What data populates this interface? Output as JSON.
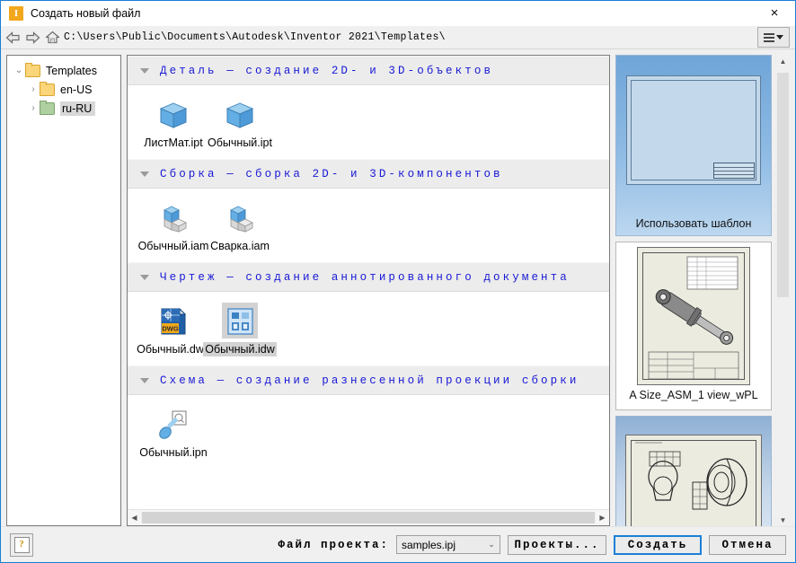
{
  "window": {
    "title": "Создать новый файл",
    "app_icon": "I",
    "close_icon": "×",
    "accent_color": "#1a7fd4"
  },
  "addressbar": {
    "back_icon": "back-arrow-icon",
    "forward_icon": "forward-arrow-icon",
    "home_icon": "home-icon",
    "path": "C:\\Users\\Public\\Documents\\Autodesk\\Inventor 2021\\Templates\\",
    "view_menu_icon": "view-options-icon"
  },
  "tree": {
    "items": [
      {
        "label": "Templates",
        "twisty": "⌄",
        "folder_color": "#fbd57a",
        "level": 0,
        "selected": false
      },
      {
        "label": "en-US",
        "twisty": "›",
        "folder_color": "#fbd57a",
        "level": 1,
        "selected": false
      },
      {
        "label": "ru-RU",
        "twisty": "›",
        "folder_color": "#aecfa0",
        "level": 1,
        "selected": true
      }
    ]
  },
  "sections": [
    {
      "title": "Деталь — создание 2D- и 3D-объектов",
      "items": [
        {
          "name": "ЛистМат.ipt",
          "icon": "part-cube-icon",
          "selected": false
        },
        {
          "name": "Обычный.ipt",
          "icon": "part-cube-icon",
          "selected": false
        }
      ]
    },
    {
      "title": "Сборка — сборка 2D- и 3D-компонентов",
      "items": [
        {
          "name": "Обычный.iam",
          "icon": "assembly-icon",
          "selected": false
        },
        {
          "name": "Сварка.iam",
          "icon": "assembly-icon",
          "selected": false
        }
      ]
    },
    {
      "title": "Чертеж — создание аннотированного документа",
      "items": [
        {
          "name": "Обычный.dwg",
          "icon": "dwg-drawing-icon",
          "selected": false
        },
        {
          "name": "Обычный.idw",
          "icon": "idw-drawing-icon",
          "selected": true
        }
      ]
    },
    {
      "title": "Схема — создание разнесенной проекции сборки",
      "items": [
        {
          "name": "Обычный.ipn",
          "icon": "presentation-icon",
          "selected": false
        }
      ]
    }
  ],
  "previews": [
    {
      "caption": "Использовать шаблон"
    },
    {
      "caption": "A Size_ASM_1 view_wPL"
    },
    {
      "caption": ""
    }
  ],
  "footer": {
    "help_glyph": "?",
    "project_file_label": "Файл проекта:",
    "project_file_value": "samples.ipj",
    "project_file_arrow": "⌄",
    "projects_button": "Проекты...",
    "create_button": "Создать",
    "cancel_button": "Отмена"
  },
  "scrollbars": {
    "left_arrow": "◀",
    "right_arrow": "▶",
    "up_arrow": "▲",
    "down_arrow": "▼"
  }
}
